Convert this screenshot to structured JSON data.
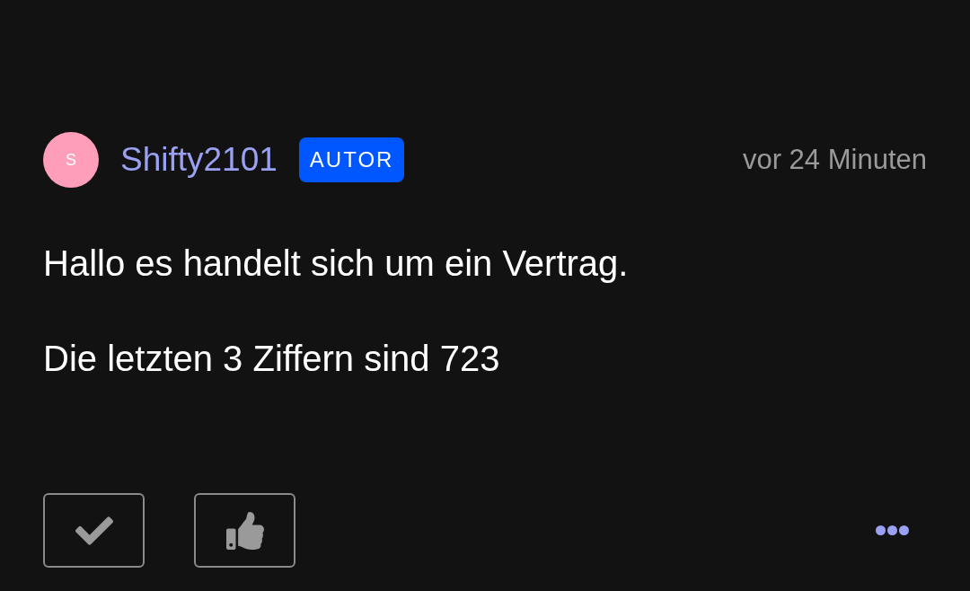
{
  "post": {
    "author": {
      "avatar_letter": "S",
      "name": "Shifty2101",
      "badge": "AUTOR"
    },
    "time": "vor 24 Minuten",
    "paragraphs": [
      "Hallo es handelt sich um ein Vertrag.",
      "Die letzten 3 Ziffern sind 723"
    ],
    "actions": [
      {
        "kind": "check"
      },
      {
        "kind": "like"
      }
    ]
  }
}
